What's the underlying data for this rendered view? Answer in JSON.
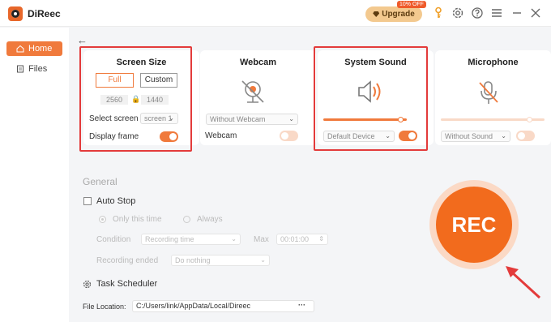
{
  "app": {
    "name": "DiReec"
  },
  "titlebar": {
    "upgrade_label": "Upgrade",
    "discount_badge": "10% OFF"
  },
  "sidebar": {
    "items": [
      {
        "label": "Home",
        "active": true
      },
      {
        "label": "Files",
        "active": false
      }
    ]
  },
  "screen_size": {
    "title": "Screen Size",
    "full_label": "Full",
    "custom_label": "Custom",
    "width": "2560",
    "height": "1440",
    "select_screen_label": "Select screen",
    "select_screen_value": "screen 1",
    "display_frame_label": "Display frame",
    "display_frame_on": true
  },
  "webcam": {
    "title": "Webcam",
    "device_value": "Without Webcam",
    "toggle_label": "Webcam",
    "toggle_on": false
  },
  "system_sound": {
    "title": "System Sound",
    "device_value": "Default Device",
    "toggle_on": true,
    "volume_fraction": 0.92
  },
  "microphone": {
    "title": "Microphone",
    "device_value": "Without Sound",
    "toggle_on": false,
    "volume_fraction": 0.85
  },
  "general": {
    "title": "General",
    "auto_stop_label": "Auto Stop",
    "only_this_time_label": "Only this time",
    "always_label": "Always",
    "condition_label": "Condition",
    "condition_value": "Recording time",
    "max_label": "Max",
    "max_value": "00:01:00",
    "recording_ended_label": "Recording ended",
    "recording_ended_value": "Do nothing",
    "task_scheduler_label": "Task Scheduler",
    "file_location_label": "File Location:",
    "file_location_value": "C:/Users/link/AppData/Local/Direec",
    "more_label": "···"
  },
  "rec": {
    "label": "REC"
  },
  "colors": {
    "accent": "#f07a3c",
    "highlight_box": "#e33b3b",
    "rec": "#f26b1d"
  }
}
